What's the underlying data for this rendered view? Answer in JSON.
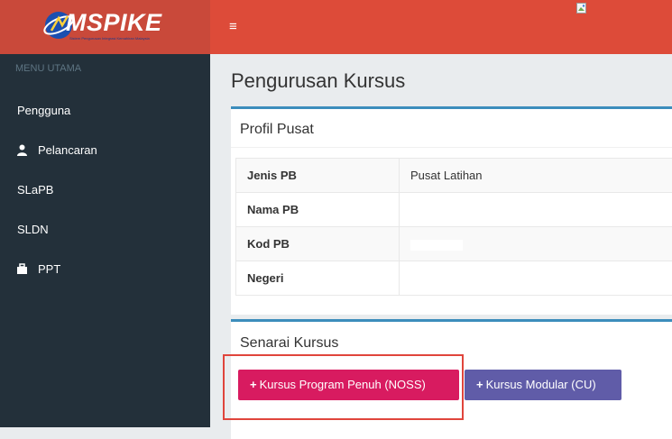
{
  "brand": {
    "logo_text": "MSPIKE",
    "logo_tagline": "Sistem Pengurusan Integrasi Kemahiran Malaysia"
  },
  "sidebar": {
    "header": "MENU UTAMA",
    "items": [
      {
        "label": "Pengguna",
        "icon": ""
      },
      {
        "label": "Pelancaran",
        "icon": "user-icon"
      },
      {
        "label": "SLaPB",
        "icon": ""
      },
      {
        "label": "SLDN",
        "icon": ""
      },
      {
        "label": "PPT",
        "icon": "briefcase-icon"
      }
    ]
  },
  "topbar": {
    "menu_toggle": "≡",
    "broken_image_icon": "broken-image-icon"
  },
  "page": {
    "title": "Pengurusan Kursus"
  },
  "profil": {
    "title": "Profil Pusat",
    "rows": [
      {
        "key": "Jenis PB",
        "value": "Pusat Latihan"
      },
      {
        "key": "Nama PB",
        "value": ""
      },
      {
        "key": "Kod PB",
        "value": ""
      },
      {
        "key": "Negeri",
        "value": ""
      }
    ]
  },
  "senarai": {
    "title": "Senarai Kursus",
    "buttons": [
      {
        "plus": "+",
        "label": "Kursus Program Penuh (NOSS)",
        "color": "#d81b60"
      },
      {
        "plus": "+",
        "label": "Kursus Modular (CU)",
        "color": "#605ca8"
      }
    ]
  },
  "colors": {
    "topbar": "#dd4b39",
    "sidebar": "#23303a",
    "box_border": "#3c8dbc",
    "highlight": "#e0453c"
  }
}
